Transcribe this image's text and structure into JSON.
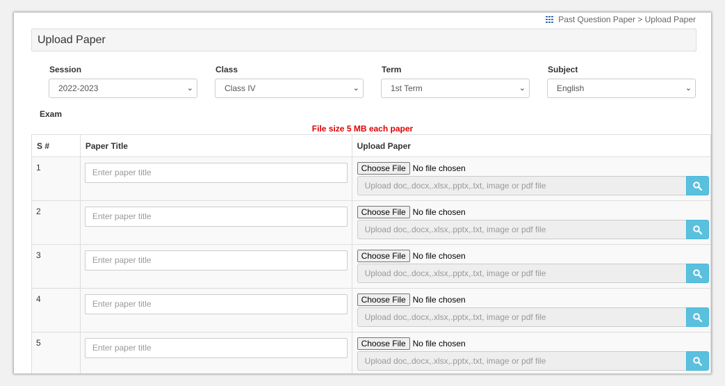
{
  "breadcrumb": {
    "icon": "grid-icon",
    "text": "Past Question Paper > Upload Paper"
  },
  "header": {
    "title": "Upload Paper"
  },
  "filters": {
    "session": {
      "label": "Session",
      "value": "2022-2023"
    },
    "class": {
      "label": "Class",
      "value": "Class IV"
    },
    "term": {
      "label": "Term",
      "value": "1st Term"
    },
    "subject": {
      "label": "Subject",
      "value": "English"
    },
    "exam": {
      "label": "Exam"
    }
  },
  "note": "File size 5 MB each paper",
  "table": {
    "headers": {
      "sn": "S #",
      "title": "Paper Title",
      "upload": "Upload Paper"
    },
    "rows": [
      {
        "sn": "1"
      },
      {
        "sn": "2"
      },
      {
        "sn": "3"
      },
      {
        "sn": "4"
      },
      {
        "sn": "5"
      }
    ],
    "title_placeholder": "Enter paper title",
    "choose_file_label": "Choose File",
    "no_file_text": "No file chosen",
    "upload_placeholder": "Upload doc,.docx,.xlsx,.pptx,.txt, image or pdf file"
  },
  "colors": {
    "note": "#e00000",
    "search_button": "#5bc0de",
    "breadcrumb_icon": "#3c73b8"
  }
}
